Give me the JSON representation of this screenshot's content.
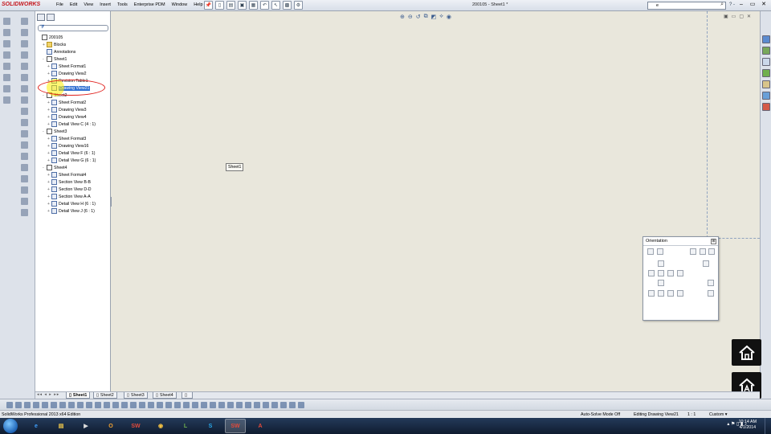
{
  "app": {
    "logo_text": "SOLIDWORKS",
    "window_title": "200105 - Sheet1 *"
  },
  "menu": [
    "File",
    "Edit",
    "View",
    "Insert",
    "Tools",
    "Enterprise PDM",
    "Window",
    "Help"
  ],
  "search": {
    "value": "e",
    "placeholder": ""
  },
  "help_group": "? -",
  "window_controls": {
    "minimize": "–",
    "restore": "▭",
    "close": "✕"
  },
  "feature_tree": {
    "collapse_glyph": "»",
    "nodes": [
      {
        "label": "200105",
        "icon": "drawing-doc-icon",
        "depth": 0,
        "expander": ""
      },
      {
        "label": "Blocks",
        "icon": "folder-icon",
        "depth": 1,
        "expander": "+"
      },
      {
        "label": "Annotations",
        "icon": "annotations-icon",
        "depth": 1,
        "expander": ""
      },
      {
        "label": "Sheet1",
        "icon": "sheet-icon",
        "depth": 1,
        "expander": "-"
      },
      {
        "label": "Sheet Format1",
        "icon": "sheet-format-icon",
        "depth": 2,
        "expander": "+"
      },
      {
        "label": "Drawing View2",
        "icon": "drawing-view-icon",
        "depth": 2,
        "expander": "+"
      },
      {
        "label": "Revision Table1",
        "icon": "table-icon",
        "depth": 2,
        "expander": "+"
      },
      {
        "label": "Drawing View21",
        "icon": "drawing-view-icon",
        "depth": 2,
        "expander": "",
        "selected": true
      },
      {
        "label": "Sheet2",
        "icon": "sheet-icon",
        "depth": 1,
        "expander": "-"
      },
      {
        "label": "Sheet Format2",
        "icon": "sheet-format-icon",
        "depth": 2,
        "expander": "+"
      },
      {
        "label": "Drawing View3",
        "icon": "drawing-view-icon",
        "depth": 2,
        "expander": "+"
      },
      {
        "label": "Drawing View4",
        "icon": "drawing-view-icon",
        "depth": 2,
        "expander": "+"
      },
      {
        "label": "Detail View C (4 : 1)",
        "icon": "detail-view-icon",
        "depth": 2,
        "expander": "+"
      },
      {
        "label": "Sheet3",
        "icon": "sheet-icon",
        "depth": 1,
        "expander": "-"
      },
      {
        "label": "Sheet Format3",
        "icon": "sheet-format-icon",
        "depth": 2,
        "expander": "+"
      },
      {
        "label": "Drawing View16",
        "icon": "drawing-view-icon",
        "depth": 2,
        "expander": "+"
      },
      {
        "label": "Detail View F (6 : 1)",
        "icon": "detail-view-icon",
        "depth": 2,
        "expander": "+"
      },
      {
        "label": "Detail View G (6 : 1)",
        "icon": "detail-view-icon",
        "depth": 2,
        "expander": "+"
      },
      {
        "label": "Sheet4",
        "icon": "sheet-icon",
        "depth": 1,
        "expander": "-"
      },
      {
        "label": "Sheet Format4",
        "icon": "sheet-format-icon",
        "depth": 2,
        "expander": "+"
      },
      {
        "label": "Section View B-B",
        "icon": "section-view-icon",
        "depth": 2,
        "expander": "+"
      },
      {
        "label": "Section View D-D",
        "icon": "section-view-icon",
        "depth": 2,
        "expander": "+"
      },
      {
        "label": "Section View A-A",
        "icon": "section-view-icon",
        "depth": 2,
        "expander": "+"
      },
      {
        "label": "Detail View H (6 : 1)",
        "icon": "detail-view-icon",
        "depth": 2,
        "expander": "+"
      },
      {
        "label": "Detail View J (6 : 1)",
        "icon": "detail-view-icon",
        "depth": 2,
        "expander": "+"
      }
    ]
  },
  "canvas": {
    "sheet_tooltip": "Sheet1"
  },
  "orientation_dialog": {
    "title": "Orientation",
    "pin": "⊞"
  },
  "sheet_tabs": {
    "nav": "◂◂ ◂ ▸ ▸▸",
    "tabs": [
      "Sheet1",
      "Sheet2",
      "Sheet3",
      "Sheet4"
    ],
    "active": "Sheet1"
  },
  "status_bar": {
    "app_name": "SolidWorks Professional 2013 x64 Edition",
    "solve_mode": "Auto-Solve Mode Off",
    "editing": "Editing Drawing View21",
    "scale": "1 : 1",
    "units": "Custom",
    "units_arrow": "▾"
  },
  "taskbar": {
    "time": "10:14 AM",
    "date": "4/1/2014",
    "tray": "▴ ⚑ ▯ ▮ ♪"
  },
  "colors": {
    "selection": "#2f6fd1",
    "annotation_red": "#e0201c",
    "cursor_yellow": "#fff000",
    "brand_red": "#c4161c"
  }
}
